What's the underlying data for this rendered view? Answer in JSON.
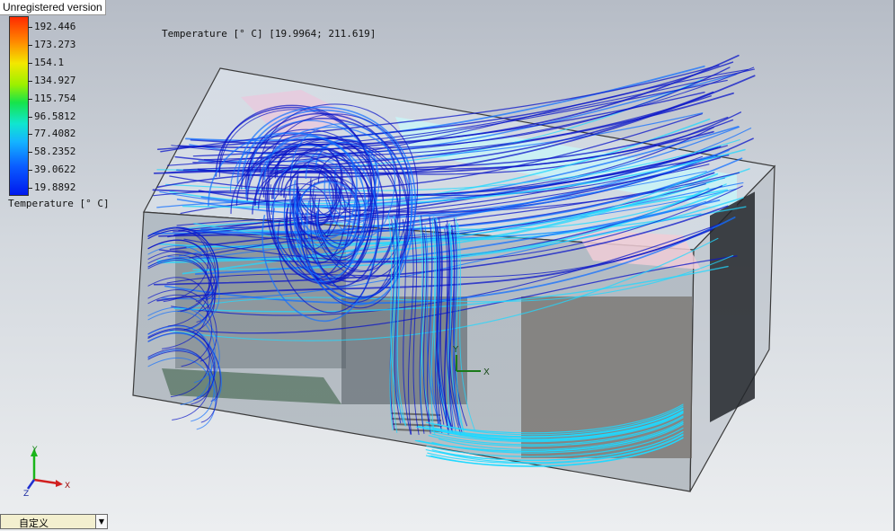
{
  "banner": "Unregistered version",
  "legend": {
    "values": [
      "192.446",
      "173.273",
      "154.1",
      "134.927",
      "115.754",
      "96.5812",
      "77.4082",
      "58.2352",
      "39.0622",
      "19.8892"
    ],
    "title": "Temperature [° C]"
  },
  "range_title": "Temperature [° C] [19.9964; 211.619]",
  "triad": {
    "x": "X",
    "y": "Y",
    "z": "Z"
  },
  "scene_axis": {
    "x": "X",
    "y": "Y"
  },
  "view_select": {
    "value": "自定义"
  },
  "colors": {
    "streamline_dark": "#0a14c8",
    "streamline_mid": "#1470ff",
    "streamline_light": "#20d8ff",
    "box_edge": "#3a3a3a"
  }
}
